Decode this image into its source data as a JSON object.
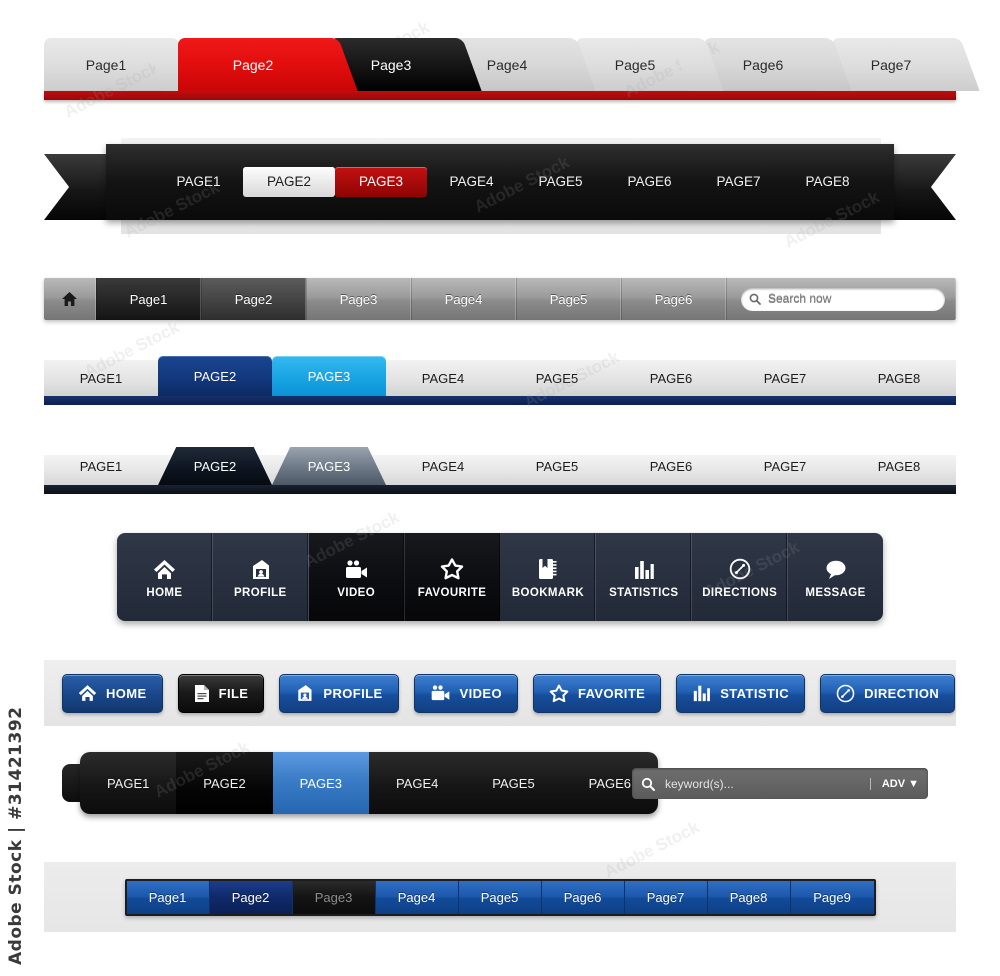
{
  "watermark": {
    "side_text": "Adobe Stock | #31421392",
    "tiles": [
      "Adobe Stock",
      "Adobe Stock",
      "Adobe Stock",
      "Adobe Stock",
      "Adobe Stock",
      "Adobe Stock",
      "Adobe Stock",
      "Adobe Stock",
      "Adobe Stock",
      "Adobe Stock",
      "Adobe Stock",
      "Adobe Stock"
    ]
  },
  "bar1": {
    "name": "red-3d-tab-bar",
    "accent": "#c10d0d",
    "tabs": [
      {
        "label": "Page1",
        "state": "normal"
      },
      {
        "label": "Page2",
        "state": "active-red"
      },
      {
        "label": "Page3",
        "state": "active-black"
      },
      {
        "label": "Page4",
        "state": "normal"
      },
      {
        "label": "Page5",
        "state": "normal"
      },
      {
        "label": "Page6",
        "state": "normal"
      },
      {
        "label": "Page7",
        "state": "normal"
      }
    ]
  },
  "bar2": {
    "name": "black-ribbon-bar",
    "accent": "#c41111",
    "items": [
      {
        "label": "PAGE1",
        "state": "normal"
      },
      {
        "label": "PAGE2",
        "state": "selected-light"
      },
      {
        "label": "PAGE3",
        "state": "selected-red"
      },
      {
        "label": "PAGE4",
        "state": "normal"
      },
      {
        "label": "PAGE5",
        "state": "normal"
      },
      {
        "label": "PAGE6",
        "state": "normal"
      },
      {
        "label": "PAGE7",
        "state": "normal"
      },
      {
        "label": "PAGE8",
        "state": "normal"
      }
    ]
  },
  "bar3": {
    "name": "grey-gradient-bar",
    "home_icon": "home-icon",
    "items": [
      {
        "label": "Page1",
        "state": "dark"
      },
      {
        "label": "Page2",
        "state": "dark-hover"
      },
      {
        "label": "Page3",
        "state": "normal"
      },
      {
        "label": "Page4",
        "state": "normal"
      },
      {
        "label": "Page5",
        "state": "normal"
      },
      {
        "label": "Page6",
        "state": "normal"
      }
    ],
    "search": {
      "icon": "search-icon",
      "placeholder": "Search now",
      "value": ""
    }
  },
  "bar4": {
    "name": "blue-rounded-tab-bar",
    "accent": "#17306b",
    "accent2": "#1aa6e4",
    "tabs": [
      {
        "label": "PAGE1",
        "state": "normal"
      },
      {
        "label": "PAGE2",
        "state": "active-navy"
      },
      {
        "label": "PAGE3",
        "state": "active-cyan"
      },
      {
        "label": "PAGE4",
        "state": "normal"
      },
      {
        "label": "PAGE5",
        "state": "normal"
      },
      {
        "label": "PAGE6",
        "state": "normal"
      },
      {
        "label": "PAGE7",
        "state": "normal"
      },
      {
        "label": "PAGE8",
        "state": "normal"
      }
    ]
  },
  "bar5": {
    "name": "trapezoid-tab-bar",
    "accent": "#0d1420",
    "tabs": [
      {
        "label": "PAGE1",
        "state": "normal"
      },
      {
        "label": "PAGE2",
        "state": "active-dark"
      },
      {
        "label": "PAGE3",
        "state": "active-grey"
      },
      {
        "label": "PAGE4",
        "state": "normal"
      },
      {
        "label": "PAGE5",
        "state": "normal"
      },
      {
        "label": "PAGE6",
        "state": "normal"
      },
      {
        "label": "PAGE7",
        "state": "normal"
      },
      {
        "label": "PAGE8",
        "state": "normal"
      }
    ]
  },
  "bar6": {
    "name": "dark-icon-button-bar",
    "buttons": [
      {
        "label": "HOME",
        "icon": "home-icon",
        "state": "normal"
      },
      {
        "label": "PROFILE",
        "icon": "profile-icon",
        "state": "normal"
      },
      {
        "label": "VIDEO",
        "icon": "video-camera-icon",
        "state": "active"
      },
      {
        "label": "FAVOURITE",
        "icon": "star-icon",
        "state": "active"
      },
      {
        "label": "BOOKMARK",
        "icon": "bookmark-notebook-icon",
        "state": "normal"
      },
      {
        "label": "STATISTICS",
        "icon": "bar-chart-icon",
        "state": "normal"
      },
      {
        "label": "DIRECTIONS",
        "icon": "compass-icon",
        "state": "normal"
      },
      {
        "label": "MESSAGE",
        "icon": "speech-bubble-icon",
        "state": "normal"
      }
    ]
  },
  "bar7": {
    "name": "blue-pill-button-bar",
    "buttons": [
      {
        "label": "HOME",
        "icon": "home-icon",
        "style": "navy"
      },
      {
        "label": "FILE",
        "icon": "document-icon",
        "style": "black"
      },
      {
        "label": "PROFILE",
        "icon": "profile-icon",
        "style": "blue"
      },
      {
        "label": "VIDEO",
        "icon": "video-camera-icon",
        "style": "blue"
      },
      {
        "label": "FAVORITE",
        "icon": "star-icon",
        "style": "blue"
      },
      {
        "label": "STATISTIC",
        "icon": "bar-chart-icon",
        "style": "blue"
      },
      {
        "label": "DIRECTION",
        "icon": "compass-icon",
        "style": "blue"
      }
    ]
  },
  "bar8": {
    "name": "dark-rounded-nav-with-search",
    "accent": "#3b7cc6",
    "items": [
      {
        "label": "PAGE1",
        "state": "normal"
      },
      {
        "label": "PAGE2",
        "state": "dark-active"
      },
      {
        "label": "PAGE3",
        "state": "blue-active"
      },
      {
        "label": "PAGE4",
        "state": "normal"
      },
      {
        "label": "PAGE5",
        "state": "normal"
      },
      {
        "label": "PAGE6",
        "state": "normal"
      }
    ],
    "search": {
      "icon": "search-icon",
      "placeholder": "keyword(s)...",
      "value": "",
      "adv_label": "ADV",
      "adv_icon": "chevron-down-icon"
    }
  },
  "bar9": {
    "name": "blue-pagination-bar",
    "accent": "#1c57ab",
    "pages": [
      {
        "label": "Page1",
        "state": "normal"
      },
      {
        "label": "Page2",
        "state": "selected"
      },
      {
        "label": "Page3",
        "state": "disabled"
      },
      {
        "label": "Page4",
        "state": "normal"
      },
      {
        "label": "Page5",
        "state": "normal"
      },
      {
        "label": "Page6",
        "state": "normal"
      },
      {
        "label": "Page7",
        "state": "normal"
      },
      {
        "label": "Page8",
        "state": "normal"
      },
      {
        "label": "Page9",
        "state": "normal"
      }
    ]
  }
}
